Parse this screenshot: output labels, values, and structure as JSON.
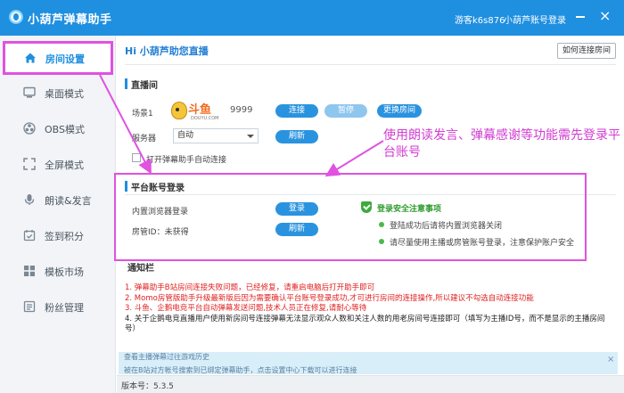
{
  "titlebar": {
    "app_title": "小葫芦弹幕助手",
    "guest": "游客k6s876",
    "login": "小葫芦账号登录",
    "minimize": "—",
    "close": "×"
  },
  "sidebar": {
    "items": [
      {
        "label": "房间设置",
        "icon": "home-icon"
      },
      {
        "label": "桌面模式",
        "icon": "desktop-icon"
      },
      {
        "label": "OBS模式",
        "icon": "obs-icon"
      },
      {
        "label": "全屏模式",
        "icon": "fullscreen-icon"
      },
      {
        "label": "朗读&发言",
        "icon": "microphone-icon"
      },
      {
        "label": "签到积分",
        "icon": "checkin-icon"
      },
      {
        "label": "模板市场",
        "icon": "template-icon"
      },
      {
        "label": "粉丝管理",
        "icon": "fans-icon"
      }
    ]
  },
  "main": {
    "greeting": "Hi 小葫芦助您直播",
    "howto_button": "如何连接房间",
    "live_section": {
      "title": "直播间",
      "scene_label": "场景1",
      "platform_text": "斗鱼",
      "platform_sub": "DOUYU.COM",
      "room_number": "9999",
      "connect_button": "连接",
      "pause_button": "暂停",
      "switch_button": "更换房间",
      "server_label": "服务器",
      "server_value": "自动",
      "refresh_button": "刷新",
      "auto_connect_label": "打开弹幕助手自动连接"
    },
    "account_section": {
      "title": "平台账号登录",
      "browser_login_label": "内置浏览器登录",
      "login_button": "登录",
      "room_admin_label": "房管ID：未获得",
      "refresh_button": "刷新",
      "safety_title": "登录安全注意事项",
      "tips": [
        "登陆成功后请将内置浏览器关闭",
        "请尽量使用主播或房管账号登录，注意保护账户安全"
      ]
    },
    "notice_section": {
      "title": "通知栏",
      "notices": [
        "1. 弹幕助手B站房间连接失败问题，已经修复，请重启电脑后打开助手即可",
        "2. Momo房管版助手升级最新版后因为需要确认平台账号登录成功,才可进行房间的连接操作,所以建议不勾选自动连接功能",
        "3. 斗鱼、企鹅电竞平台自动弹幕发送问题,技术人员正在修复,请耐心等待"
      ],
      "notice_4": "4. 关于企鹅电竞直播用户使用新房间号连接弹幕无法显示观众人数和关注人数的用老房间号连接即可（填写为主播ID号，而不是显示的主播房间号）"
    },
    "banner": {
      "line1": "查看主播弹幕过往游戏历史",
      "line2": "被在B站对方帐号搜索到已绑定弹幕助手，点击设置中心下载可以进行连接",
      "close": "×"
    },
    "version": "版本号：5.3.5"
  },
  "annotation": {
    "text": "使用朗读发言、弹幕感谢等功能需先登录平台账号"
  },
  "colors": {
    "brand_blue": "#1f8fe0",
    "highlight_magenta": "#e052e0",
    "notice_red": "#e02020",
    "success_green": "#3daa3d"
  }
}
